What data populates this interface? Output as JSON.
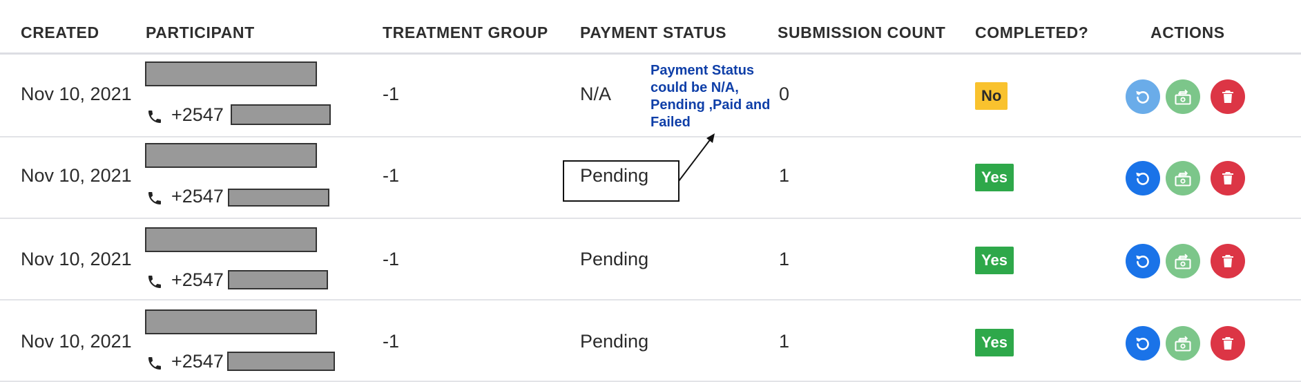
{
  "columns": {
    "created": "CREATED",
    "participant": "PARTICIPANT",
    "treatment_group": "TREATMENT GROUP",
    "payment_status": "PAYMENT STATUS",
    "submission_count": "SUBMISSION COUNT",
    "completed": "COMPLETED?",
    "actions": "ACTIONS"
  },
  "rows": [
    {
      "created": "Nov 10, 2021",
      "phone_prefix": "+2547",
      "treatment_group": "-1",
      "payment_status": "N/A",
      "submission_count": "0",
      "completed": "No"
    },
    {
      "created": "Nov 10, 2021",
      "phone_prefix": "+2547",
      "treatment_group": "-1",
      "payment_status": "Pending",
      "submission_count": "1",
      "completed": "Yes"
    },
    {
      "created": "Nov 10, 2021",
      "phone_prefix": "+2547",
      "treatment_group": "-1",
      "payment_status": "Pending",
      "submission_count": "1",
      "completed": "Yes"
    },
    {
      "created": "Nov 10, 2021",
      "phone_prefix": "+2547",
      "treatment_group": "-1",
      "payment_status": "Pending",
      "submission_count": "1",
      "completed": "Yes"
    }
  ],
  "annotation": {
    "line1": "Payment Status",
    "line2": "could be N/A,",
    "line3": "Pending ,Paid and",
    "line4": "Failed"
  },
  "icons": {
    "phone": "phone-icon",
    "reset": "refresh-icon",
    "pay": "cash-icon",
    "delete": "trash-icon"
  },
  "colors": {
    "badge_no": "#f9c22e",
    "badge_yes": "#2ea84a",
    "refresh_button": "#1a73e8",
    "refresh_button_disabled": "#6aace9",
    "pay_button": "#7cc68a",
    "delete_button": "#dc3545",
    "annotation_text": "#0f3fa8"
  }
}
